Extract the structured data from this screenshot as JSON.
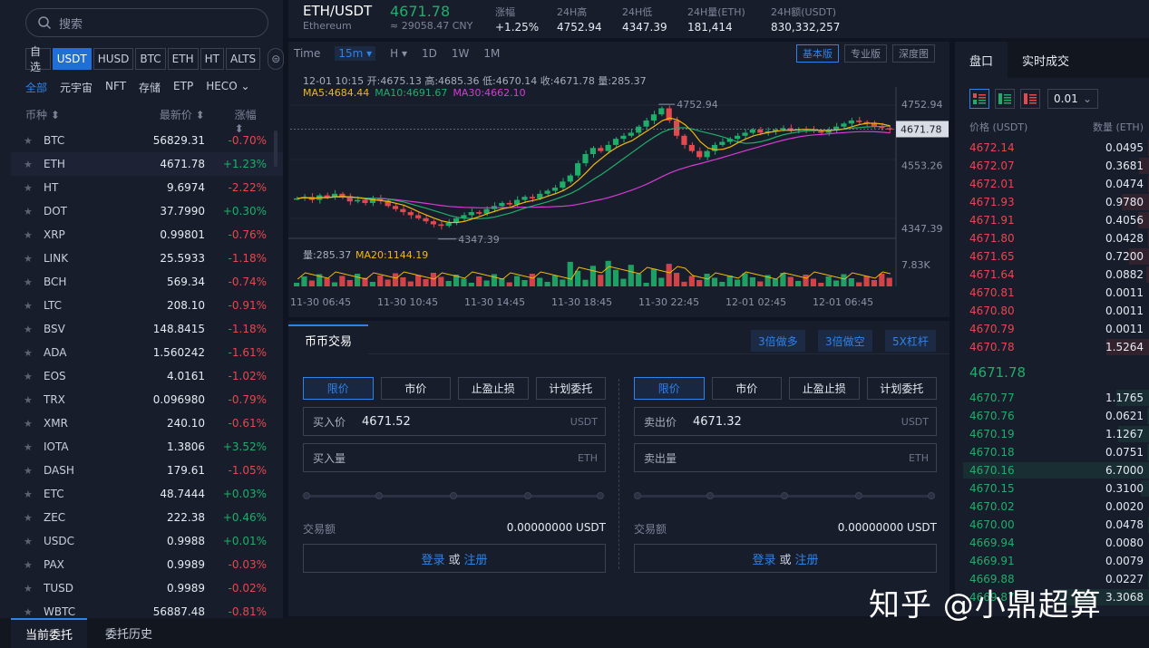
{
  "search": {
    "placeholder": "搜索"
  },
  "quote_tabs": [
    "自选",
    "USDT",
    "HUSD",
    "BTC",
    "ETH",
    "HT",
    "ALTS"
  ],
  "quote_tab_active": 1,
  "categories": [
    "全部",
    "元宇宙",
    "NFT",
    "存储",
    "ETP",
    "HECO ⌄"
  ],
  "category_active": 0,
  "list_header": {
    "col1": "币种 ⬍",
    "col2": "最新价 ⬍",
    "col3": "涨幅 ⬍"
  },
  "coins": [
    {
      "sym": "BTC",
      "price": "56829.31",
      "chg": "-0.70%",
      "dir": "down"
    },
    {
      "sym": "ETH",
      "price": "4671.78",
      "chg": "+1.23%",
      "dir": "up",
      "selected": true
    },
    {
      "sym": "HT",
      "price": "9.6974",
      "chg": "-2.22%",
      "dir": "down"
    },
    {
      "sym": "DOT",
      "price": "37.7990",
      "chg": "+0.30%",
      "dir": "up"
    },
    {
      "sym": "XRP",
      "price": "0.99801",
      "chg": "-0.76%",
      "dir": "down"
    },
    {
      "sym": "LINK",
      "price": "25.5933",
      "chg": "-1.18%",
      "dir": "down"
    },
    {
      "sym": "BCH",
      "price": "569.34",
      "chg": "-0.74%",
      "dir": "down"
    },
    {
      "sym": "LTC",
      "price": "208.10",
      "chg": "-0.91%",
      "dir": "down"
    },
    {
      "sym": "BSV",
      "price": "148.8415",
      "chg": "-1.18%",
      "dir": "down"
    },
    {
      "sym": "ADA",
      "price": "1.560242",
      "chg": "-1.61%",
      "dir": "down"
    },
    {
      "sym": "EOS",
      "price": "4.0161",
      "chg": "-1.02%",
      "dir": "down"
    },
    {
      "sym": "TRX",
      "price": "0.096980",
      "chg": "-0.79%",
      "dir": "down"
    },
    {
      "sym": "XMR",
      "price": "240.10",
      "chg": "-0.61%",
      "dir": "down"
    },
    {
      "sym": "IOTA",
      "price": "1.3806",
      "chg": "+3.52%",
      "dir": "up"
    },
    {
      "sym": "DASH",
      "price": "179.61",
      "chg": "-1.05%",
      "dir": "down"
    },
    {
      "sym": "ETC",
      "price": "48.7444",
      "chg": "+0.03%",
      "dir": "up"
    },
    {
      "sym": "ZEC",
      "price": "222.38",
      "chg": "+0.46%",
      "dir": "up"
    },
    {
      "sym": "USDC",
      "price": "0.9988",
      "chg": "+0.01%",
      "dir": "up"
    },
    {
      "sym": "PAX",
      "price": "0.9989",
      "chg": "-0.03%",
      "dir": "down"
    },
    {
      "sym": "TUSD",
      "price": "0.9989",
      "chg": "-0.02%",
      "dir": "down"
    },
    {
      "sym": "WBTC",
      "price": "56887.48",
      "chg": "-0.81%",
      "dir": "down"
    }
  ],
  "ticker": {
    "pair": "ETH/USDT",
    "name": "Ethereum",
    "last": "4671.78",
    "cny": "≈ 29058.47 CNY",
    "stats": [
      {
        "label": "涨幅",
        "value": "+1.25%"
      },
      {
        "label": "24H高",
        "value": "4752.94"
      },
      {
        "label": "24H低",
        "value": "4347.39"
      },
      {
        "label": "24H量(ETH)",
        "value": "181,414"
      },
      {
        "label": "24H额(USDT)",
        "value": "830,332,257"
      }
    ]
  },
  "chart_toolbar": {
    "items": [
      "Time",
      "15m ▾",
      "H ▾",
      "1D",
      "1W",
      "1M"
    ],
    "active": 1,
    "modes": [
      "基本版",
      "专业版",
      "深度图"
    ],
    "mode_active": 0
  },
  "chart_info": {
    "ohlc": "12-01 10:15  开:4675.13 高:4685.36 低:4670.14 收:4671.78 量:285.37",
    "ma5": "MA5:4684.44",
    "ma10": "MA10:4691.67",
    "ma30": "MA30:4662.10",
    "vol": "量:285.37",
    "ma20": "MA20:1144.19",
    "high_label": "4752.94",
    "low_label": "4347.39",
    "last_tag": "4671.78",
    "vol_axis": "7.83K"
  },
  "chart_data": {
    "type": "candlestick",
    "y_ticks": [
      4752.94,
      4553.26,
      4347.39
    ],
    "x_ticks": [
      "11-30 06:45",
      "11-30 10:45",
      "11-30 14:45",
      "11-30 18:45",
      "11-30 22:45",
      "12-01 02:45",
      "12-01 06:45"
    ],
    "close_path": [
      4445,
      4450,
      4440,
      4455,
      4448,
      4460,
      4452,
      4435,
      4440,
      4430,
      4445,
      4438,
      4420,
      4410,
      4400,
      4390,
      4380,
      4370,
      4360,
      4355,
      4365,
      4380,
      4390,
      4400,
      4395,
      4410,
      4420,
      4430,
      4425,
      4440,
      4450,
      4445,
      4460,
      4470,
      4480,
      4500,
      4520,
      4560,
      4590,
      4610,
      4600,
      4620,
      4640,
      4650,
      4660,
      4680,
      4700,
      4720,
      4740,
      4700,
      4650,
      4620,
      4600,
      4580,
      4600,
      4620,
      4630,
      4640,
      4650,
      4660,
      4670,
      4660,
      4665,
      4670,
      4675,
      4668,
      4672,
      4670,
      4665,
      4660,
      4670,
      4680,
      4690,
      4700,
      4695,
      4690,
      4680,
      4675,
      4671.78
    ],
    "series": [
      {
        "name": "MA5"
      },
      {
        "name": "MA10"
      },
      {
        "name": "MA30"
      }
    ]
  },
  "trade": {
    "tab": "币币交易",
    "leverage": [
      "3倍做多",
      "3倍做空",
      "5X杠杆"
    ],
    "order_types": [
      "限价",
      "市价",
      "止盈止损",
      "计划委托"
    ],
    "buy": {
      "price_label": "买入价",
      "price": "4671.52",
      "qty_label": "买入量",
      "amount_label": "交易额",
      "amount": "0.00000000 USDT"
    },
    "sell": {
      "price_label": "卖出价",
      "price": "4671.32",
      "qty_label": "卖出量",
      "amount_label": "交易额",
      "amount": "0.00000000 USDT"
    },
    "quote_unit": "USDT",
    "base_unit": "ETH",
    "login": "登录",
    "or": "或",
    "register": "注册"
  },
  "orderbook": {
    "tabs": [
      "盘口",
      "实时成交"
    ],
    "precision": "0.01",
    "head_price": "价格 (USDT)",
    "head_qty": "数量 (ETH)",
    "asks": [
      {
        "p": "4672.14",
        "q": "0.0495"
      },
      {
        "p": "4672.07",
        "q": "0.3681"
      },
      {
        "p": "4672.01",
        "q": "0.0474"
      },
      {
        "p": "4671.93",
        "q": "0.9780"
      },
      {
        "p": "4671.91",
        "q": "0.4056"
      },
      {
        "p": "4671.80",
        "q": "0.0428"
      },
      {
        "p": "4671.65",
        "q": "0.7200"
      },
      {
        "p": "4671.64",
        "q": "0.0882"
      },
      {
        "p": "4670.81",
        "q": "0.0011"
      },
      {
        "p": "4670.80",
        "q": "0.0011"
      },
      {
        "p": "4670.79",
        "q": "0.0011"
      },
      {
        "p": "4670.78",
        "q": "1.5264"
      }
    ],
    "last": "4671.78",
    "bids": [
      {
        "p": "4670.77",
        "q": "1.1765"
      },
      {
        "p": "4670.76",
        "q": "0.0621"
      },
      {
        "p": "4670.19",
        "q": "1.1267"
      },
      {
        "p": "4670.18",
        "q": "0.0751"
      },
      {
        "p": "4670.16",
        "q": "6.7000"
      },
      {
        "p": "4670.15",
        "q": "0.3100"
      },
      {
        "p": "4670.02",
        "q": "0.0020"
      },
      {
        "p": "4670.00",
        "q": "0.0478"
      },
      {
        "p": "4669.94",
        "q": "0.0080"
      },
      {
        "p": "4669.91",
        "q": "0.0079"
      },
      {
        "p": "4669.88",
        "q": "0.0227"
      },
      {
        "p": "4669.87",
        "q": "3.3068"
      }
    ]
  },
  "bottom_tabs": [
    "当前委托",
    "委托历史"
  ],
  "watermark": "知乎 @小鼎超算",
  "colors": {
    "up": "#1fae6a",
    "down": "#e5484d",
    "accent": "#2f82e8"
  }
}
